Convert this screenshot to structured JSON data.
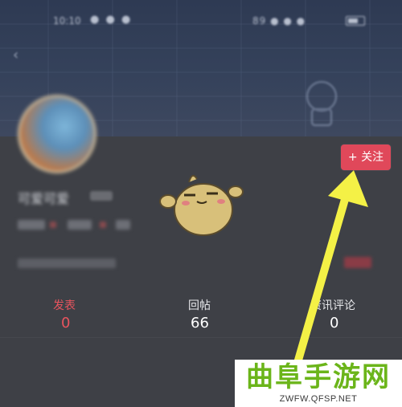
{
  "statusbar": {
    "time": "10:10",
    "notification_icons": "● ● ●",
    "network": "89 ● ● ●"
  },
  "profile": {
    "username": "可爱可爱",
    "follow_label": "+ 关注"
  },
  "stats": [
    {
      "label": "发表",
      "value": "0",
      "color": "#e8545e"
    },
    {
      "label": "回帖",
      "value": "66",
      "color": "#ffffff"
    },
    {
      "label": "资讯评论",
      "value": "0",
      "color": "#ffffff"
    }
  ],
  "annotation": {
    "arrow_color": "#f4f146"
  },
  "watermark": {
    "title": "曲阜手游网",
    "url": "ZWFW.QFSP.NET"
  },
  "colors": {
    "accent": "#e0485a",
    "watermark_green": "#6bb51a",
    "background": "#3e4046"
  }
}
